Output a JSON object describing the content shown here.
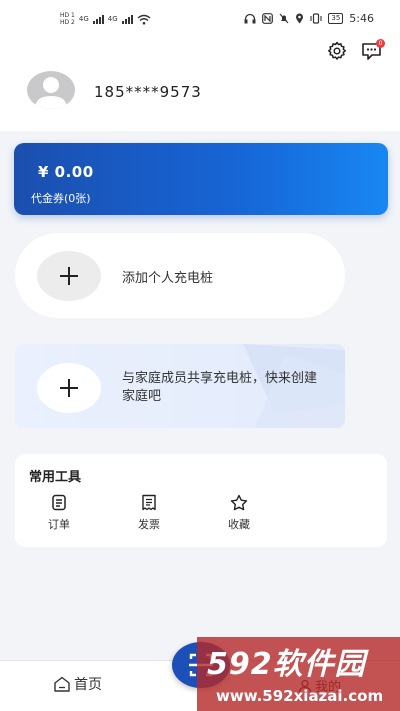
{
  "status_bar": {
    "hd1": "HD 1",
    "hd2": "HD 2",
    "net1": "4G",
    "net2": "4G",
    "battery": "35",
    "time": "5:46"
  },
  "header": {
    "phone": "185****9573",
    "message_badge": "0"
  },
  "voucher": {
    "amount": "¥ 0.00",
    "label": "代金券(0张)"
  },
  "add_charger": {
    "label": "添加个人充电桩"
  },
  "family": {
    "label": "与家庭成员共享充电桩，快来创建家庭吧"
  },
  "tools": {
    "title": "常用工具",
    "items": [
      {
        "label": "订单",
        "icon": "order-icon"
      },
      {
        "label": "发票",
        "icon": "invoice-icon"
      },
      {
        "label": "收藏",
        "icon": "star-icon"
      }
    ]
  },
  "nav": {
    "home": "首页",
    "mine": "我的"
  },
  "watermark": {
    "logo": "592软件园",
    "url": "www.592xiazai.com"
  },
  "colors": {
    "primary": "#1765d6",
    "badge": "#ee3b3b"
  }
}
